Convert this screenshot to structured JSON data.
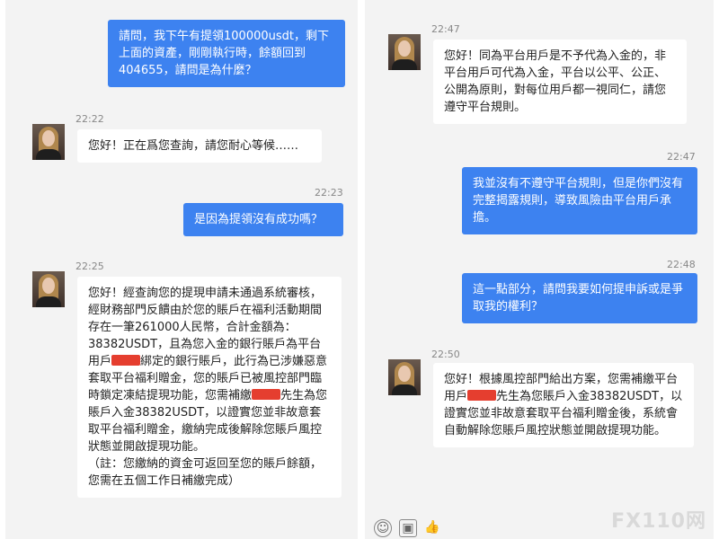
{
  "left": {
    "messages": [
      {
        "time": "",
        "text": "請問，我下午有提領100000usdt，剩下上面的資產，剛剛執行時，餘額回到404655，請問是為什麼？"
      },
      {
        "time": "22:22",
        "text": "您好！正在爲您查詢，請您耐心等候……"
      },
      {
        "time": "22:23",
        "text": "是因為提領沒有成功嗎？"
      },
      {
        "time": "22:25",
        "p1": "您好！經查詢您的提現申請未通過系統審核，經財務部門反饋由於您的賬戶在福利活動期間存在一筆261000人民幣，合計金額為：38382USDT，且為您入金的銀行賬戶為平台用戶",
        "p2": "綁定的銀行賬戶，此行為已涉嫌惡意套取平台福利贈金，您的賬戶已被風控部門臨時鎖定凍結提現功能，您需補繳",
        "p3": "先生為您賬戶入金38382USDT，以證實您並非故意套取平台福利贈金，繳納完成後解除您賬戶風控狀態並開啟提現功能。",
        "note": "（註：您繳納的資金可返回至您的賬戶餘額，您需在五個工作日補繳完成）"
      }
    ]
  },
  "right": {
    "messages": [
      {
        "time": "22:47",
        "text": "您好！同為平台用戶是不予代為入金的，非平台用戶可代為入金，平台以公平、公正、公開為原則，對每位用戶都一視同仁，請您遵守平台規則。"
      },
      {
        "time": "22:47",
        "text": "我並沒有不遵守平台規則，但是你們沒有完整揭露規則，導致風險由平台用戶承擔。"
      },
      {
        "time": "22:48",
        "text": "這一點部分，請問我要如何提申訴或是爭取我的權利？"
      },
      {
        "time": "22:50",
        "p1": "您好！根據風控部門給出方案，您需補繳平台用戶",
        "p2": "先生為您賬戶入金38382USDT，以證實您並非故意套取平台福利贈金後，系統會自動解除您賬戶風控狀態並開啟提現功能。"
      }
    ]
  },
  "watermark": "FX110网",
  "toolbar": {
    "icons": [
      "emoji-icon",
      "image-icon",
      "thumbs-up-icon"
    ]
  }
}
